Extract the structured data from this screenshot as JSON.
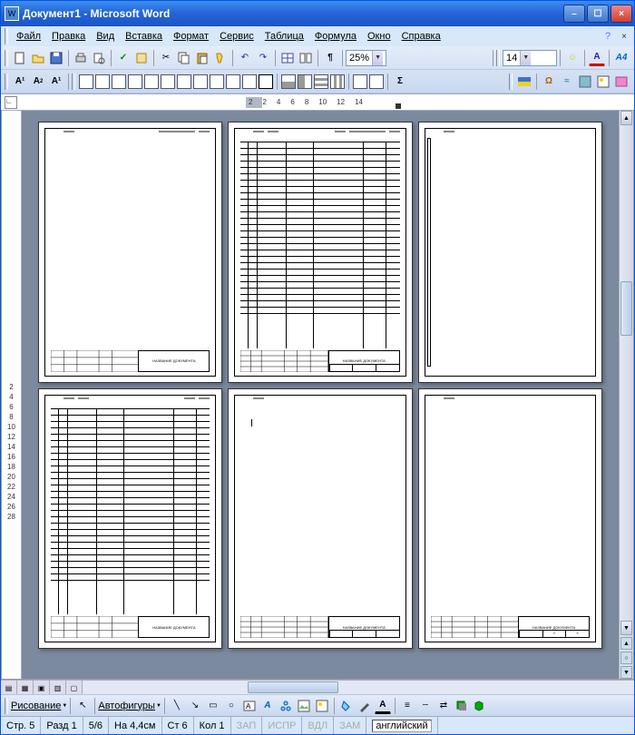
{
  "title": "Документ1 - Microsoft Word",
  "menu": {
    "file": "Файл",
    "edit": "Правка",
    "view": "Вид",
    "insert": "Вставка",
    "format": "Формат",
    "service": "Сервис",
    "table": "Таблица",
    "formula": "Формула",
    "window": "Окно",
    "help": "Справка"
  },
  "toolbar": {
    "zoom": "25%",
    "font_size": "14"
  },
  "ruler_ticks": [
    "2",
    "2",
    "4",
    "6",
    "8",
    "10",
    "12",
    "14"
  ],
  "vruler_ticks": [
    "2",
    "4",
    "6",
    "8",
    "10",
    "12",
    "14",
    "16",
    "18",
    "20",
    "22",
    "24",
    "26",
    "28"
  ],
  "doc_label": "НАЗВАНИЕ ДОКУМЕНТА",
  "draw": {
    "drawing": "Рисование",
    "autoshapes": "Автофигуры"
  },
  "status": {
    "page": "Стр. 5",
    "section": "Разд 1",
    "pages": "5/6",
    "at": "На 4,4см",
    "line": "Ст 6",
    "col": "Кол 1",
    "rec": "ЗАП",
    "trk": "ИСПР",
    "ext": "ВДЛ",
    "ovr": "ЗАМ",
    "lang": "английский"
  }
}
